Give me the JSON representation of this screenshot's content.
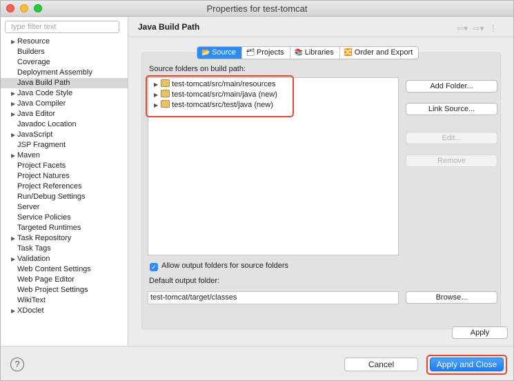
{
  "window": {
    "title": "Properties for test-tomcat"
  },
  "sidebar": {
    "filter_placeholder": "type filter text",
    "items": [
      {
        "label": "Resource",
        "expandable": true
      },
      {
        "label": "Builders",
        "expandable": false
      },
      {
        "label": "Coverage",
        "expandable": false
      },
      {
        "label": "Deployment Assembly",
        "expandable": false
      },
      {
        "label": "Java Build Path",
        "expandable": false,
        "selected": true
      },
      {
        "label": "Java Code Style",
        "expandable": true
      },
      {
        "label": "Java Compiler",
        "expandable": true
      },
      {
        "label": "Java Editor",
        "expandable": true
      },
      {
        "label": "Javadoc Location",
        "expandable": false
      },
      {
        "label": "JavaScript",
        "expandable": true
      },
      {
        "label": "JSP Fragment",
        "expandable": false
      },
      {
        "label": "Maven",
        "expandable": true
      },
      {
        "label": "Project Facets",
        "expandable": false
      },
      {
        "label": "Project Natures",
        "expandable": false
      },
      {
        "label": "Project References",
        "expandable": false
      },
      {
        "label": "Run/Debug Settings",
        "expandable": false
      },
      {
        "label": "Server",
        "expandable": false
      },
      {
        "label": "Service Policies",
        "expandable": false
      },
      {
        "label": "Targeted Runtimes",
        "expandable": false
      },
      {
        "label": "Task Repository",
        "expandable": true
      },
      {
        "label": "Task Tags",
        "expandable": false
      },
      {
        "label": "Validation",
        "expandable": true
      },
      {
        "label": "Web Content Settings",
        "expandable": false
      },
      {
        "label": "Web Page Editor",
        "expandable": false
      },
      {
        "label": "Web Project Settings",
        "expandable": false
      },
      {
        "label": "WikiText",
        "expandable": false
      },
      {
        "label": "XDoclet",
        "expandable": true
      }
    ]
  },
  "main": {
    "title": "Java Build Path",
    "tabs": [
      {
        "label": "Source",
        "icon": "source-folder-icon",
        "active": true
      },
      {
        "label": "Projects",
        "icon": "projects-icon",
        "active": false
      },
      {
        "label": "Libraries",
        "icon": "libraries-icon",
        "active": false
      },
      {
        "label": "Order and Export",
        "icon": "order-export-icon",
        "active": false
      }
    ],
    "source_label": "Source folders on build path:",
    "source_folders": [
      "test-tomcat/src/main/resources",
      "test-tomcat/src/main/java (new)",
      "test-tomcat/src/test/java (new)"
    ],
    "buttons": {
      "add_folder": "Add Folder...",
      "link_source": "Link Source...",
      "edit": "Edit...",
      "remove": "Remove",
      "browse": "Browse...",
      "apply": "Apply"
    },
    "allow_output_label": "Allow output folders for source folders",
    "allow_output_checked": true,
    "default_output_label": "Default output folder:",
    "default_output_value": "test-tomcat/target/classes"
  },
  "footer": {
    "help": "?",
    "cancel": "Cancel",
    "apply_close": "Apply and Close"
  },
  "colors": {
    "accent": "#2d8bf5",
    "highlight": "#e8462f"
  }
}
